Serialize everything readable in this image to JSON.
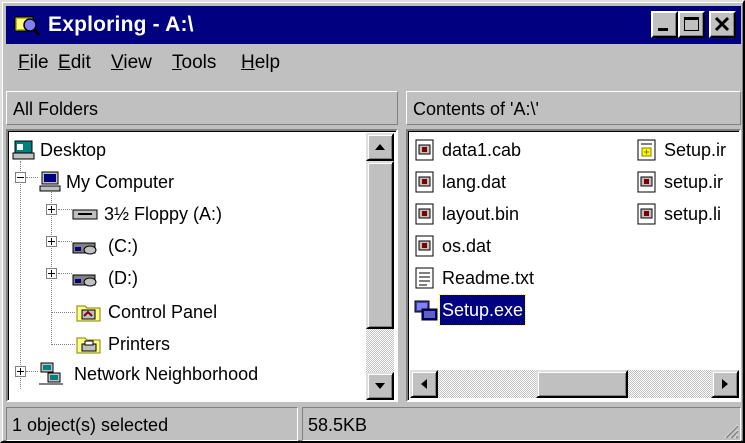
{
  "window": {
    "title": "Exploring - A:\\"
  },
  "menu": [
    {
      "accel": "F",
      "rest": "ile"
    },
    {
      "accel": "E",
      "rest": "dit"
    },
    {
      "accel": "V",
      "rest": "iew"
    },
    {
      "accel": "T",
      "rest": "ools"
    },
    {
      "accel": "H",
      "rest": "elp"
    }
  ],
  "left_header": "All Folders",
  "right_header": "Contents of 'A:\\'",
  "tree": [
    {
      "label": "Desktop",
      "icon": "desktop-icon"
    },
    {
      "label": "My Computer",
      "icon": "computer-icon"
    },
    {
      "label": "3½ Floppy (A:)",
      "icon": "floppy-drive-icon"
    },
    {
      "label": "(C:)",
      "icon": "hard-drive-icon"
    },
    {
      "label": "(D:)",
      "icon": "hard-drive-icon"
    },
    {
      "label": "Control Panel",
      "icon": "control-panel-icon"
    },
    {
      "label": "Printers",
      "icon": "printers-icon"
    },
    {
      "label": "Network Neighborhood",
      "icon": "network-icon"
    }
  ],
  "files": [
    {
      "label": "data1.cab",
      "icon": "file-icon"
    },
    {
      "label": "lang.dat",
      "icon": "file-icon"
    },
    {
      "label": "layout.bin",
      "icon": "file-icon"
    },
    {
      "label": "os.dat",
      "icon": "file-icon"
    },
    {
      "label": "Readme.txt",
      "icon": "text-file-icon"
    },
    {
      "label": "Setup.exe",
      "icon": "setup-exe-icon",
      "selected": true
    },
    {
      "label": "Setup.ir",
      "icon": "settings-file-icon"
    },
    {
      "label": "setup.ir",
      "icon": "file-icon"
    },
    {
      "label": "setup.li",
      "icon": "file-icon"
    }
  ],
  "status": {
    "selected": "1 object(s) selected",
    "size": "58.5KB"
  },
  "colors": {
    "titlebar": "#000080",
    "face": "#c0c0c0",
    "selection": "#000080"
  }
}
